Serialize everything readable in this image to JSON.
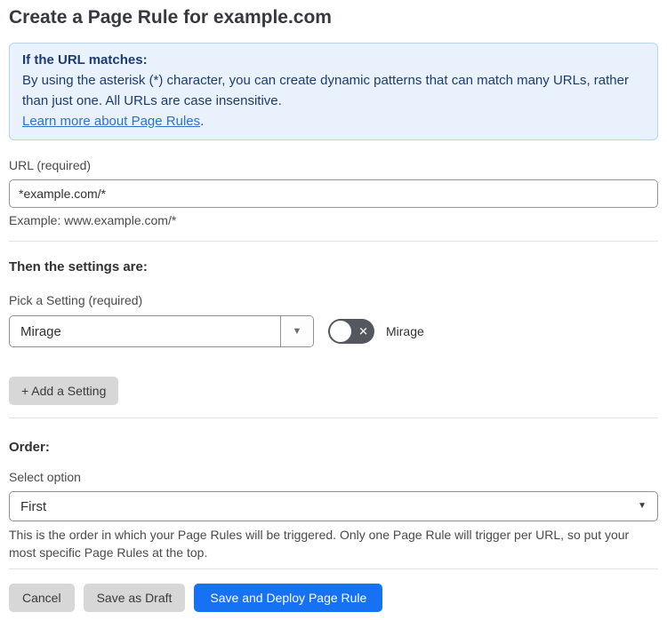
{
  "page": {
    "title": "Create a Page Rule for example.com"
  },
  "info_box": {
    "heading": "If the URL matches:",
    "body": "By using the asterisk (*) character, you can create dynamic patterns that can match many URLs, rather than just one. All URLs are case insensitive.",
    "link_label": "Learn more about Page Rules",
    "link_suffix": "."
  },
  "url_section": {
    "label": "URL (required)",
    "value": "*example.com/*",
    "example": "Example: www.example.com/*"
  },
  "settings_section": {
    "heading": "Then the settings are:",
    "picker_label": "Pick a Setting (required)",
    "picker_value": "Mirage",
    "toggle_label": "Mirage",
    "toggle_state": "off",
    "add_button_label": "+ Add a Setting"
  },
  "order_section": {
    "heading": "Order:",
    "label": "Select option",
    "value": "First",
    "help": "This is the order in which your Page Rules will be triggered. Only one Page Rule will trigger per URL, so put your most specific Page Rules at the top."
  },
  "footer": {
    "cancel_label": "Cancel",
    "save_draft_label": "Save as Draft",
    "save_deploy_label": "Save and Deploy Page Rule"
  },
  "icons": {
    "dropdown_caret": "▼",
    "toggle_off": "✕"
  },
  "colors": {
    "primary_button": "#1672f2",
    "info_box_bg": "#e9f2fc",
    "info_box_border": "#b9d4f2",
    "info_text": "#1d3c6e",
    "link": "#3270cc",
    "toggle_off_bg": "#53575e",
    "gray_button_bg": "#d7d7d7",
    "divider": "#e3e3e3"
  }
}
